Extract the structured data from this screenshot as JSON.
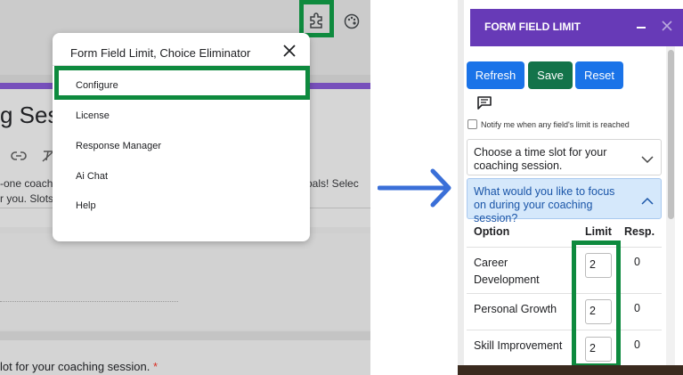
{
  "forms_editor": {
    "title_fragment": "g Sess",
    "description_line1": "-one coach",
    "description_line1b": "r goals! Selec",
    "description_line2": "r you. Slots",
    "question_fragment": "lot for your coaching session.",
    "required_marker": "*"
  },
  "addon_menu": {
    "title": "Form Field Limit, Choice Eliminator",
    "items": [
      {
        "label": "Configure"
      },
      {
        "label": "License"
      },
      {
        "label": "Response Manager"
      },
      {
        "label": "Ai Chat"
      },
      {
        "label": "Help"
      }
    ]
  },
  "panel": {
    "title": "FORM FIELD LIMIT",
    "buttons": {
      "refresh": "Refresh",
      "save": "Save",
      "reset": "Reset"
    },
    "notify_label": "Notify me when any field's limit is reached",
    "questions": [
      {
        "text": "Choose a time slot for your coaching session.",
        "expanded": false
      },
      {
        "text": "What would you like to focus on during your coaching session?",
        "expanded": true
      }
    ],
    "table": {
      "headers": {
        "option": "Option",
        "limit": "Limit",
        "responses": "Resp."
      },
      "rows": [
        {
          "option": "Career Development",
          "limit": "2",
          "responses": "0"
        },
        {
          "option": "Personal Growth",
          "limit": "2",
          "responses": "0"
        },
        {
          "option": "Skill Improvement",
          "limit": "2",
          "responses": "0"
        }
      ]
    }
  },
  "colors": {
    "accent_purple": "#673ab7",
    "highlight_green": "#0e8a3e",
    "button_blue": "#1a73e8",
    "button_green": "#13734a",
    "arrow_blue": "#3a6fd8"
  },
  "icons": [
    "puzzle-icon",
    "palette-icon",
    "close-icon",
    "link-icon",
    "chat-icon",
    "chevron-down-icon",
    "chevron-up-icon",
    "right-arrow-icon",
    "minimize-icon"
  ]
}
